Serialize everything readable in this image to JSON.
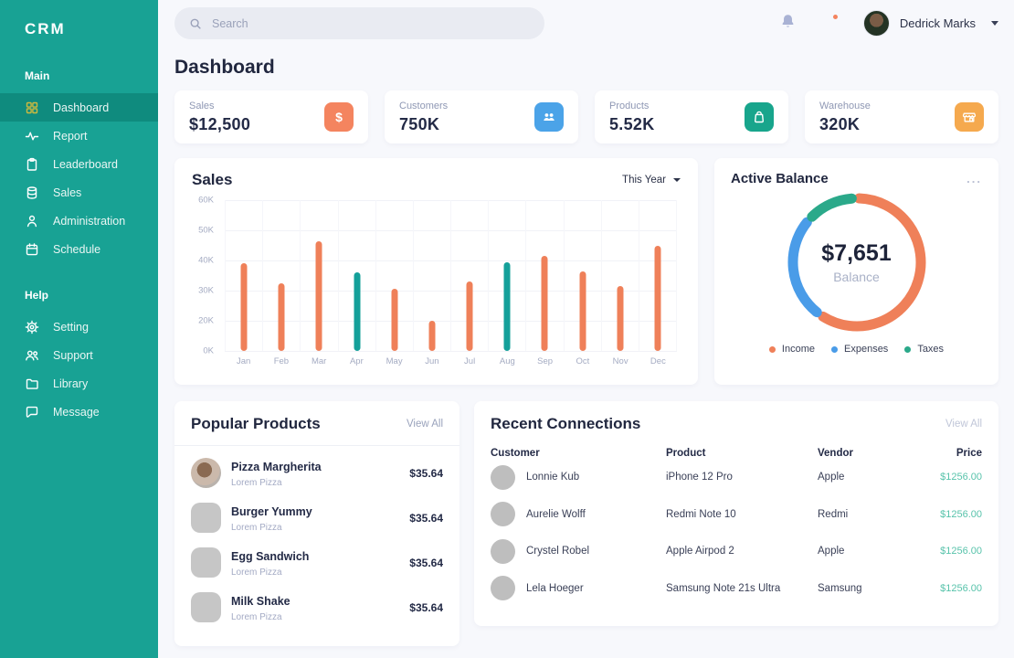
{
  "app_logo": "CRM",
  "header": {
    "search_placeholder": "Search",
    "user_name": "Dedrick Marks"
  },
  "sidebar": {
    "sections": [
      {
        "label": "Main",
        "items": [
          {
            "label": "Dashboard",
            "icon": "grid-icon",
            "active": true
          },
          {
            "label": "Report",
            "icon": "activity-icon",
            "active": false
          },
          {
            "label": "Leaderboard",
            "icon": "clipboard-icon",
            "active": false
          },
          {
            "label": "Sales",
            "icon": "database-icon",
            "active": false
          },
          {
            "label": "Administration",
            "icon": "user-icon",
            "active": false
          },
          {
            "label": "Schedule",
            "icon": "calendar-icon",
            "active": false
          }
        ]
      },
      {
        "label": "Help",
        "items": [
          {
            "label": "Setting",
            "icon": "gear-icon",
            "active": false
          },
          {
            "label": "Support",
            "icon": "users-icon",
            "active": false
          },
          {
            "label": "Library",
            "icon": "folder-icon",
            "active": false
          },
          {
            "label": "Message",
            "icon": "chat-icon",
            "active": false
          }
        ]
      }
    ]
  },
  "page_title": "Dashboard",
  "stats": [
    {
      "label": "Sales",
      "value": "$12,500",
      "icon": "dollar-icon",
      "color": "#F4845F"
    },
    {
      "label": "Customers",
      "value": "750K",
      "icon": "people-icon",
      "color": "#4BA3E8"
    },
    {
      "label": "Products",
      "value": "5.52K",
      "icon": "bag-icon",
      "color": "#18A58C"
    },
    {
      "label": "Warehouse",
      "value": "320K",
      "icon": "store-icon",
      "color": "#F5A94E"
    }
  ],
  "sales_card": {
    "title": "Sales",
    "filter_label": "This Year"
  },
  "balance_card": {
    "title": "Active Balance",
    "menu_glyph": "...",
    "center_value": "$7,651",
    "center_label": "Balance"
  },
  "popular_products": {
    "title": "Popular Products",
    "view_all": "View All",
    "items": [
      {
        "name": "Pizza Margherita",
        "subtitle": "Lorem Pizza",
        "price": "$35.64",
        "thumb": "photo"
      },
      {
        "name": "Burger Yummy",
        "subtitle": "Lorem Pizza",
        "price": "$35.64",
        "thumb": "square"
      },
      {
        "name": "Egg Sandwich",
        "subtitle": "Lorem Pizza",
        "price": "$35.64",
        "thumb": "square"
      },
      {
        "name": "Milk Shake",
        "subtitle": "Lorem Pizza",
        "price": "$35.64",
        "thumb": "square"
      }
    ]
  },
  "recent_connections": {
    "title": "Recent Connections",
    "view_all": "View All",
    "columns": [
      "Customer",
      "Product",
      "Vendor",
      "Price"
    ],
    "rows": [
      {
        "customer": "Lonnie Kub",
        "product": "iPhone 12 Pro",
        "vendor": "Apple",
        "price": "$1256.00"
      },
      {
        "customer": "Aurelie Wolff",
        "product": "Redmi Note 10",
        "vendor": "Redmi",
        "price": "$1256.00"
      },
      {
        "customer": "Crystel Robel",
        "product": "Apple Airpod 2",
        "vendor": "Apple",
        "price": "$1256.00"
      },
      {
        "customer": "Lela Hoeger",
        "product": "Samsung Note 21s Ultra",
        "vendor": "Samsung",
        "price": "$1256.00"
      }
    ]
  },
  "chart_data": [
    {
      "type": "bar",
      "title": "Sales",
      "filter": "This Year",
      "categories": [
        "Jan",
        "Feb",
        "Mar",
        "Apr",
        "May",
        "Jun",
        "Jul",
        "Aug",
        "Sep",
        "Oct",
        "Nov",
        "Dec"
      ],
      "values": [
        39,
        32.5,
        46.5,
        36,
        30.5,
        20,
        33,
        39.5,
        41.5,
        36.5,
        31.5,
        45
      ],
      "unit": "K",
      "y_ticks": [
        "60K",
        "50K",
        "40K",
        "30K",
        "20K",
        "0K"
      ],
      "y_tick_values": [
        60,
        50,
        40,
        30,
        20,
        0
      ],
      "colors": [
        "#EF8059",
        "#EF8059",
        "#EF8059",
        "#14A09A",
        "#EF8059",
        "#EF8059",
        "#EF8059",
        "#14A09A",
        "#EF8059",
        "#EF8059",
        "#EF8059",
        "#EF8059"
      ],
      "grid": true,
      "legend_position": "none"
    },
    {
      "type": "pie",
      "title": "Active Balance",
      "center_value": "$7,651",
      "center_label": "Balance",
      "slices": [
        {
          "label": "Income",
          "pct": 61,
          "sweep_deg": 210,
          "color": "#EF8059"
        },
        {
          "label": "Expenses",
          "pct": 27,
          "sweep_deg": 90,
          "color": "#4A9CE8"
        },
        {
          "label": "Taxes",
          "pct": 12,
          "sweep_deg": 40,
          "color": "#2BA98A"
        }
      ],
      "legend_position": "bottom"
    }
  ],
  "colors": {
    "sidebar": "#18A294",
    "sidebar_active": "#0F8B7E",
    "active_icon": "#CDBA3F",
    "background": "#F7F8FC",
    "orange": "#EF8059",
    "teal": "#14A09A",
    "blue": "#4A9CE8",
    "green": "#2BA98A",
    "amber": "#F5A94E",
    "price_text": "#58C3AB"
  }
}
